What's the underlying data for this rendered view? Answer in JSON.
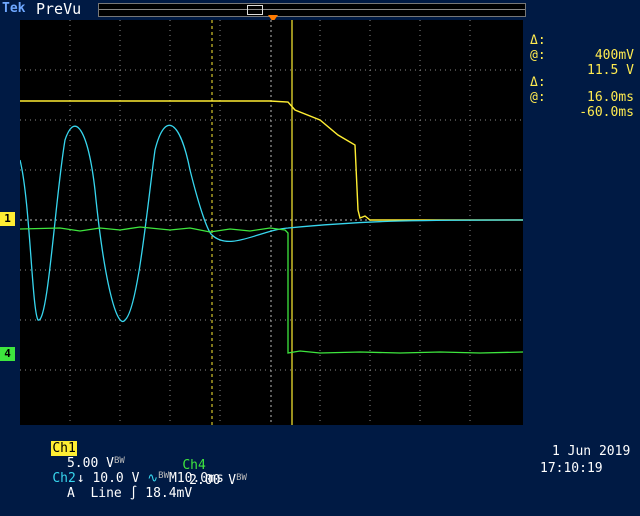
{
  "header": {
    "brand": "Tek",
    "status": "PreVu"
  },
  "readouts": {
    "voltage_delta_label": "Δ:",
    "voltage_delta": "400mV",
    "voltage_at_label": "@:",
    "voltage_at": "11.5 V",
    "time_delta_label": "Δ:",
    "time_delta": "16.0ms",
    "time_at_label": "@:",
    "time_at": "-60.0ms"
  },
  "channels": {
    "ch1": {
      "label": "Ch1",
      "scale": "5.00 V",
      "marker": "1",
      "color": "#ffee33"
    },
    "ch2": {
      "label": "Ch2",
      "scale": "10.0 V",
      "coupling": "∿",
      "color": "#37d6ee"
    },
    "ch4": {
      "label": "Ch4",
      "scale": "2.00 V",
      "marker": "4",
      "color": "#3ee63e"
    }
  },
  "timebase": {
    "label": "M",
    "value": "10.0ms"
  },
  "trigger": {
    "mode": "A",
    "source": "Line",
    "slope": "∫",
    "level": "18.4mV"
  },
  "bw_mark": "BW",
  "timestamp": {
    "date": "1 Jun  2019",
    "time": "17:10:19"
  }
}
